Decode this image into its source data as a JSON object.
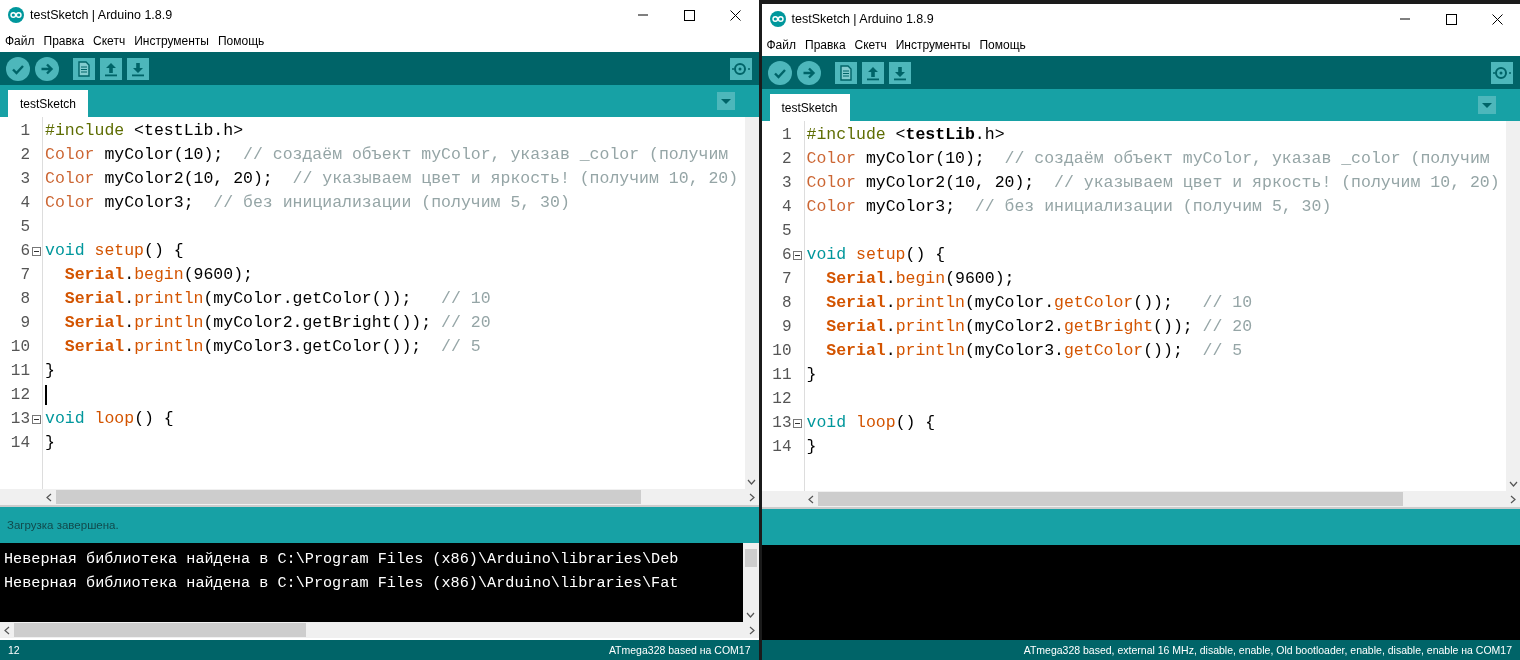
{
  "windows": [
    {
      "title": "testSketch | Arduino 1.8.9",
      "menu": [
        "Файл",
        "Правка",
        "Скетч",
        "Инструменты",
        "Помощь"
      ],
      "tabs": [
        {
          "label": "testSketch",
          "selected": true
        }
      ],
      "editor": {
        "lines": [
          {
            "number": "1",
            "fold": false,
            "cursor": false,
            "segments": [
              {
                "t": "#include",
                "kind": "preproc"
              },
              {
                "t": " <testLib.h>",
                "kind": "plain"
              }
            ]
          },
          {
            "number": "2",
            "fold": false,
            "cursor": false,
            "segments": [
              {
                "t": "Color",
                "kind": "type"
              },
              {
                "t": " myColor(10);  ",
                "kind": "plain"
              },
              {
                "t": "// создаём объект myColor, указав _color (получим",
                "kind": "comment"
              }
            ]
          },
          {
            "number": "3",
            "fold": false,
            "cursor": false,
            "segments": [
              {
                "t": "Color",
                "kind": "type"
              },
              {
                "t": " myColor2(10, 20);  ",
                "kind": "plain"
              },
              {
                "t": "// указываем цвет и яркость! (получим 10, 20)",
                "kind": "comment"
              }
            ]
          },
          {
            "number": "4",
            "fold": false,
            "cursor": false,
            "segments": [
              {
                "t": "Color",
                "kind": "type"
              },
              {
                "t": " myColor3;  ",
                "kind": "plain"
              },
              {
                "t": "// без инициализации (получим 5, 30)",
                "kind": "comment"
              }
            ]
          },
          {
            "number": "5",
            "fold": false,
            "cursor": false
          },
          {
            "number": "6",
            "fold": true,
            "cursor": false,
            "segments": [
              {
                "t": "void ",
                "kind": "keyword"
              },
              {
                "t": "setup",
                "kind": "func"
              },
              {
                "t": "() {",
                "kind": "plain"
              }
            ]
          },
          {
            "number": "7",
            "fold": false,
            "cursor": false,
            "segments": [
              {
                "t": "  Serial",
                "kind": "class"
              },
              {
                "t": ".",
                "kind": "plain"
              },
              {
                "t": "begin",
                "kind": "func"
              },
              {
                "t": "(9600);",
                "kind": "plain"
              }
            ]
          },
          {
            "number": "8",
            "fold": false,
            "cursor": false,
            "segments": [
              {
                "t": "  Serial",
                "kind": "class"
              },
              {
                "t": ".",
                "kind": "plain"
              },
              {
                "t": "println",
                "kind": "func"
              },
              {
                "t": "(myColor.getColor());   ",
                "kind": "plain"
              },
              {
                "t": "// 10",
                "kind": "comment"
              }
            ]
          },
          {
            "number": "9",
            "fold": false,
            "cursor": false,
            "segments": [
              {
                "t": "  Serial",
                "kind": "class"
              },
              {
                "t": ".",
                "kind": "plain"
              },
              {
                "t": "println",
                "kind": "func"
              },
              {
                "t": "(myColor2.getBright()); ",
                "kind": "plain"
              },
              {
                "t": "// 20",
                "kind": "comment"
              }
            ]
          },
          {
            "number": "10",
            "fold": false,
            "cursor": false,
            "segments": [
              {
                "t": "  Serial",
                "kind": "class"
              },
              {
                "t": ".",
                "kind": "plain"
              },
              {
                "t": "println",
                "kind": "func"
              },
              {
                "t": "(myColor3.getColor());  ",
                "kind": "plain"
              },
              {
                "t": "// 5",
                "kind": "comment"
              }
            ]
          },
          {
            "number": "11",
            "fold": false,
            "cursor": false,
            "segments": [
              {
                "t": "}",
                "kind": "plain"
              }
            ]
          },
          {
            "number": "12",
            "fold": false,
            "cursor": true
          },
          {
            "number": "13",
            "fold": true,
            "cursor": false,
            "segments": [
              {
                "t": "void ",
                "kind": "keyword"
              },
              {
                "t": "loop",
                "kind": "func"
              },
              {
                "t": "() {",
                "kind": "plain"
              }
            ]
          },
          {
            "number": "14",
            "fold": false,
            "cursor": false,
            "segments": [
              {
                "t": "}",
                "kind": "plain"
              }
            ]
          }
        ]
      },
      "message": "Загрузка завершена.",
      "console": [
        "Неверная библиотека найдена в C:\\Program Files (x86)\\Arduino\\libraries\\Deb",
        "Неверная библиотека найдена в C:\\Program Files (x86)\\Arduino\\libraries\\Fat"
      ],
      "status": {
        "line": "12",
        "board": "ATmega328 based на COM17"
      }
    },
    {
      "title": "testSketch | Arduino 1.8.9",
      "menu": [
        "Файл",
        "Правка",
        "Скетч",
        "Инструменты",
        "Помощь"
      ],
      "tabs": [
        {
          "label": "testSketch",
          "selected": true
        }
      ],
      "editor": {
        "lines": [
          {
            "number": "1",
            "fold": false,
            "cursor": false,
            "segments": [
              {
                "t": "#include",
                "kind": "preproc"
              },
              {
                "t": " <",
                "kind": "plain"
              },
              {
                "t": "testLib",
                "kind": "lib"
              },
              {
                "t": ".h>",
                "kind": "plain"
              }
            ]
          },
          {
            "number": "2",
            "fold": false,
            "cursor": false,
            "segments": [
              {
                "t": "Color",
                "kind": "type"
              },
              {
                "t": " myColor(10);  ",
                "kind": "plain"
              },
              {
                "t": "// создаём объект myColor, указав _color (получим",
                "kind": "comment"
              }
            ]
          },
          {
            "number": "3",
            "fold": false,
            "cursor": false,
            "segments": [
              {
                "t": "Color",
                "kind": "type"
              },
              {
                "t": " myColor2(10, 20);  ",
                "kind": "plain"
              },
              {
                "t": "// указываем цвет и яркость! (получим 10, 20)",
                "kind": "comment"
              }
            ]
          },
          {
            "number": "4",
            "fold": false,
            "cursor": false,
            "segments": [
              {
                "t": "Color",
                "kind": "type"
              },
              {
                "t": " myColor3;  ",
                "kind": "plain"
              },
              {
                "t": "// без инициализации (получим 5, 30)",
                "kind": "comment"
              }
            ]
          },
          {
            "number": "5",
            "fold": false,
            "cursor": false
          },
          {
            "number": "6",
            "fold": true,
            "cursor": false,
            "segments": [
              {
                "t": "void ",
                "kind": "keyword"
              },
              {
                "t": "setup",
                "kind": "func"
              },
              {
                "t": "() {",
                "kind": "plain"
              }
            ]
          },
          {
            "number": "7",
            "fold": false,
            "cursor": false,
            "segments": [
              {
                "t": "  Serial",
                "kind": "class"
              },
              {
                "t": ".",
                "kind": "plain"
              },
              {
                "t": "begin",
                "kind": "func"
              },
              {
                "t": "(9600);",
                "kind": "plain"
              }
            ]
          },
          {
            "number": "8",
            "fold": false,
            "cursor": false,
            "segments": [
              {
                "t": "  Serial",
                "kind": "class"
              },
              {
                "t": ".",
                "kind": "plain"
              },
              {
                "t": "println",
                "kind": "func"
              },
              {
                "t": "(myColor.",
                "kind": "plain"
              },
              {
                "t": "getColor",
                "kind": "func"
              },
              {
                "t": "());   ",
                "kind": "plain"
              },
              {
                "t": "// 10",
                "kind": "comment"
              }
            ]
          },
          {
            "number": "9",
            "fold": false,
            "cursor": false,
            "segments": [
              {
                "t": "  Serial",
                "kind": "class"
              },
              {
                "t": ".",
                "kind": "plain"
              },
              {
                "t": "println",
                "kind": "func"
              },
              {
                "t": "(myColor2.",
                "kind": "plain"
              },
              {
                "t": "getBright",
                "kind": "func"
              },
              {
                "t": "()); ",
                "kind": "plain"
              },
              {
                "t": "// 20",
                "kind": "comment"
              }
            ]
          },
          {
            "number": "10",
            "fold": false,
            "cursor": false,
            "segments": [
              {
                "t": "  Serial",
                "kind": "class"
              },
              {
                "t": ".",
                "kind": "plain"
              },
              {
                "t": "println",
                "kind": "func"
              },
              {
                "t": "(myColor3.",
                "kind": "plain"
              },
              {
                "t": "getColor",
                "kind": "func"
              },
              {
                "t": "());  ",
                "kind": "plain"
              },
              {
                "t": "// 5",
                "kind": "comment"
              }
            ]
          },
          {
            "number": "11",
            "fold": false,
            "cursor": false,
            "segments": [
              {
                "t": "}",
                "kind": "plain"
              }
            ]
          },
          {
            "number": "12",
            "fold": false,
            "cursor": false
          },
          {
            "number": "13",
            "fold": true,
            "cursor": false,
            "segments": [
              {
                "t": "void ",
                "kind": "keyword"
              },
              {
                "t": "loop",
                "kind": "func"
              },
              {
                "t": "() {",
                "kind": "plain"
              }
            ]
          },
          {
            "number": "14",
            "fold": false,
            "cursor": false,
            "segments": [
              {
                "t": "}",
                "kind": "plain"
              }
            ]
          }
        ]
      },
      "status": {
        "board": "ATmega328 based, external 16 MHz, disable, enable, Old bootloader, enable, disable, enable на COM17"
      }
    }
  ]
}
